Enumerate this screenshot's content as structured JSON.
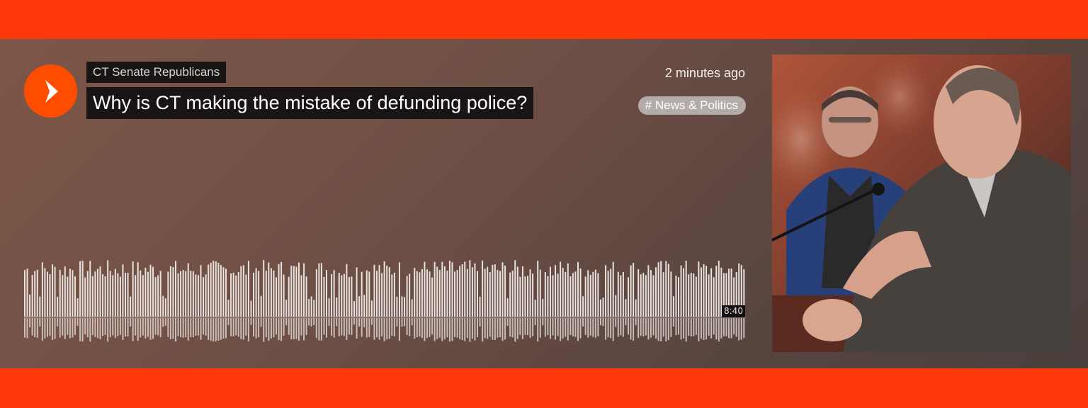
{
  "player": {
    "author": "CT Senate Republicans",
    "title": "Why is CT making the mistake of defunding police?",
    "timestamp": "2 minutes ago",
    "tag": "# News & Politics",
    "duration": "8:40",
    "progress": 0
  },
  "icons": {
    "play": "play-icon",
    "artwork": "track-artwork"
  },
  "colors": {
    "brand": "#ff3a0a",
    "play_button": "#ff4d00",
    "waveform_bar": "#e8e2df"
  }
}
